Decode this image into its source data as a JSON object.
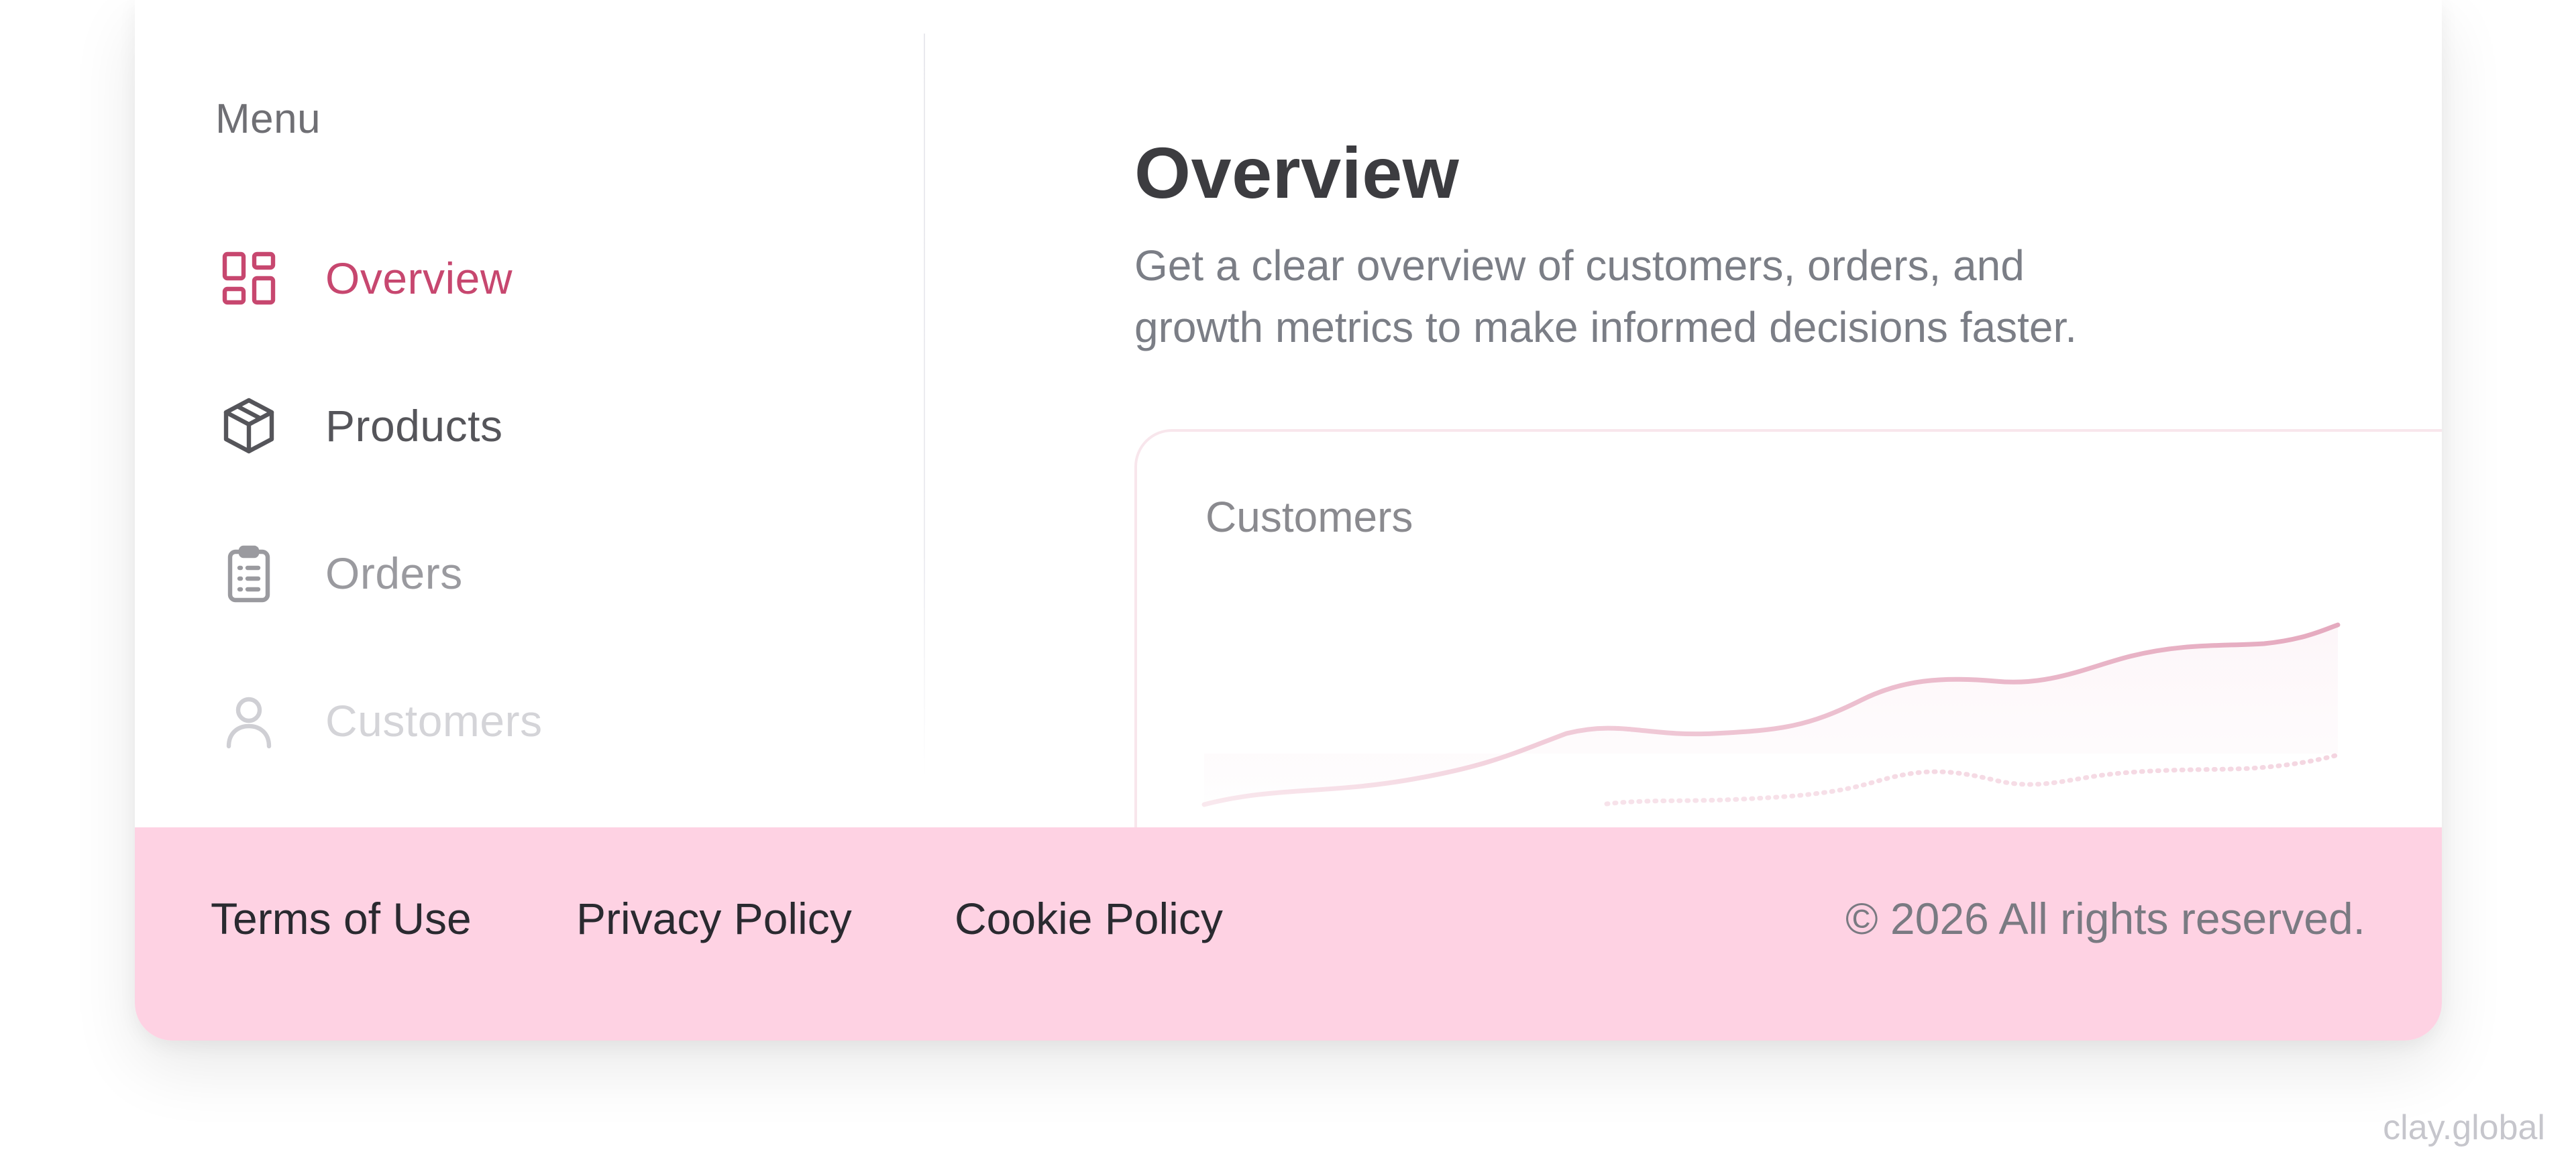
{
  "sidebar": {
    "title": "Menu",
    "items": [
      {
        "label": "Overview",
        "icon": "dashboard-icon",
        "state": "active"
      },
      {
        "label": "Products",
        "icon": "box-icon",
        "state": "normal"
      },
      {
        "label": "Orders",
        "icon": "clipboard-list-icon",
        "state": "faded"
      },
      {
        "label": "Customers",
        "icon": "user-icon",
        "state": "faded"
      }
    ]
  },
  "main": {
    "title": "Overview",
    "description_line1": "Get a clear overview of customers, orders, and",
    "description_line2": "growth metrics to make informed decisions faster.",
    "chart_card": {
      "title": "Customers"
    }
  },
  "footer": {
    "links": [
      "Terms of Use",
      "Privacy Policy",
      "Cookie Policy"
    ],
    "copyright": "© 2026 All rights reserved."
  },
  "watermark": "clay.global",
  "colors": {
    "accent": "#c7476f",
    "footer_bg": "#fed2e3",
    "chart_line": "#e7b3c6"
  }
}
